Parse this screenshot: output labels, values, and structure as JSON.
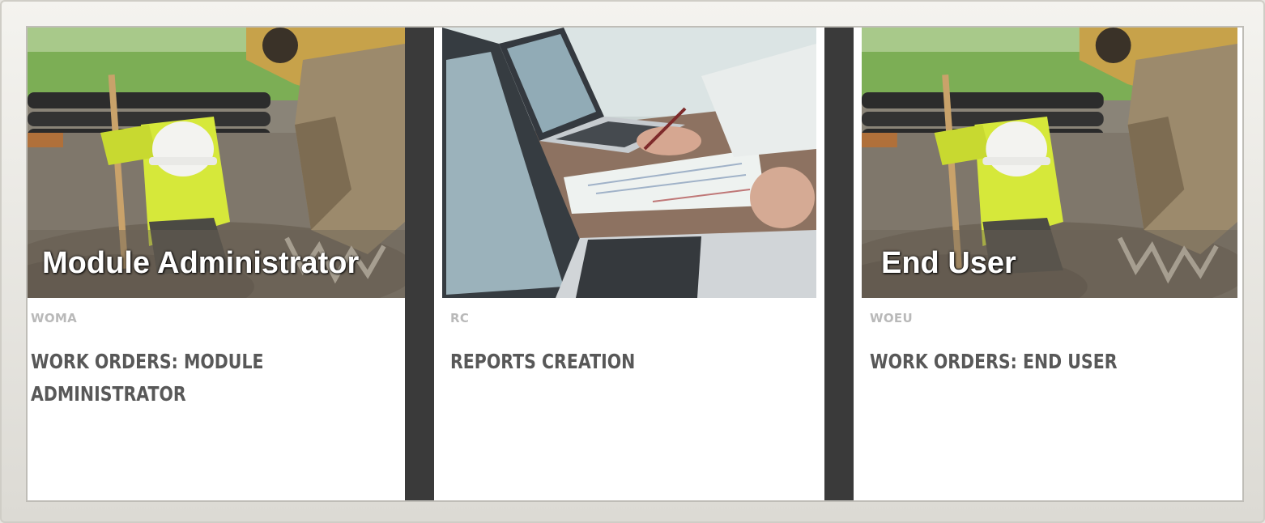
{
  "cards": [
    {
      "overlay_title": "Module Administrator",
      "code": "WOMA",
      "title": "WORK ORDERS: MODULE ADMINISTRATOR",
      "image": "construction-worker-excavator"
    },
    {
      "overlay_title": "",
      "code": "RC",
      "title": "REPORTS CREATION",
      "image": "laptops-desk-meeting"
    },
    {
      "overlay_title": "End User",
      "code": "WOEU",
      "title": "WORK ORDERS: END USER",
      "image": "construction-worker-excavator"
    }
  ],
  "colors": {
    "card_background": "#ffffff",
    "divider": "#3a3a3a",
    "code_text": "#b9b9b9",
    "title_text": "#585858"
  }
}
